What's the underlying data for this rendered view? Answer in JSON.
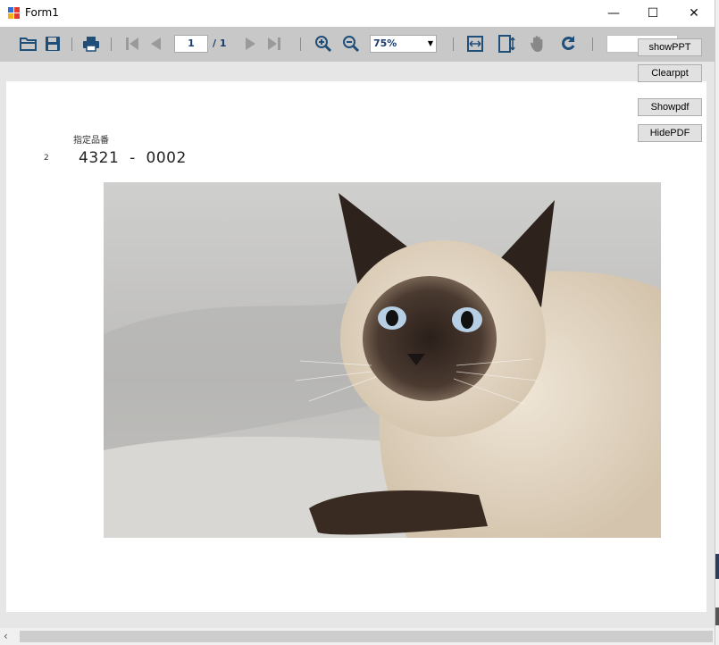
{
  "window": {
    "title": "Form1",
    "minimize_glyph": "—",
    "maximize_glyph": "☐",
    "close_glyph": "✕"
  },
  "toolbar": {
    "icons": [
      "open-folder-icon",
      "save-icon",
      "print-icon",
      "first-page-icon",
      "previous-page-icon",
      "next-page-icon",
      "last-page-icon",
      "zoom-in-icon",
      "zoom-out-icon",
      "fit-width-icon",
      "fit-page-icon",
      "hand-tool-icon",
      "rotate-icon"
    ],
    "page_current": "1",
    "page_total": "/ 1",
    "zoom": "75%",
    "search_value": ""
  },
  "buttons": {
    "show_ppt": "showPPT",
    "clear_ppt": "Clearppt",
    "show_pdf": "Showpdf",
    "hide_pdf": "HidePDF"
  },
  "document": {
    "label": "指定品番",
    "row_number": "2",
    "part_number": "4321  -  0002",
    "image": "siamese-cat-photo"
  },
  "scrollbar": {
    "left_arrow": "‹"
  },
  "colors": {
    "toolbar_bg": "#c8c8c8",
    "icon_blue": "#1f4e79",
    "viewer_bg": "#e6e6e6"
  }
}
